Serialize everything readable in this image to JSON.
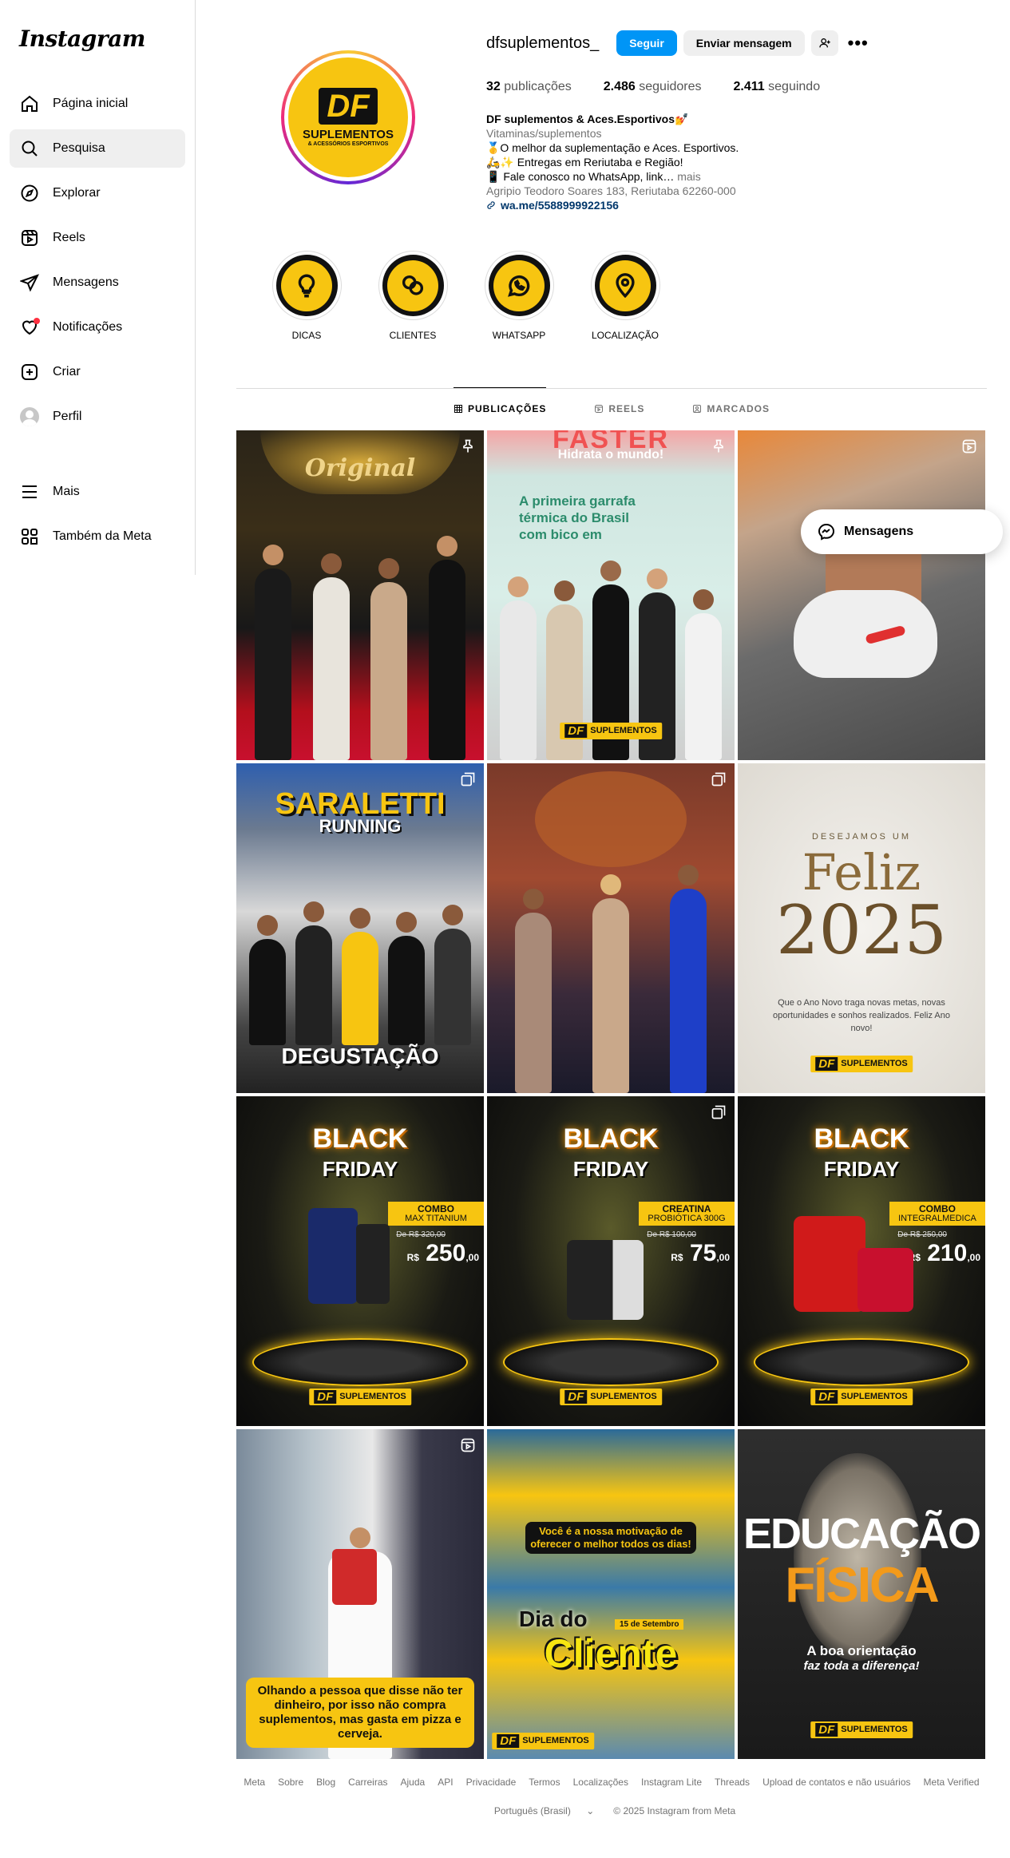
{
  "app": {
    "logo": "Instagram"
  },
  "sidebar": {
    "items": [
      {
        "label": "Página inicial",
        "icon": "home-icon"
      },
      {
        "label": "Pesquisa",
        "icon": "search-icon"
      },
      {
        "label": "Explorar",
        "icon": "compass-icon"
      },
      {
        "label": "Reels",
        "icon": "reels-icon"
      },
      {
        "label": "Mensagens",
        "icon": "send-icon"
      },
      {
        "label": "Notificações",
        "icon": "heart-icon"
      },
      {
        "label": "Criar",
        "icon": "plus-square-icon"
      },
      {
        "label": "Perfil",
        "icon": "avatar"
      }
    ],
    "bottom": [
      {
        "label": "Mais",
        "icon": "menu-icon"
      },
      {
        "label": "Também da Meta",
        "icon": "meta-apps-icon"
      }
    ]
  },
  "profile": {
    "username": "dfsuplementos_",
    "follow_label": "Seguir",
    "message_label": "Enviar mensagem",
    "stats": {
      "posts_count": "32",
      "posts_label": "publicações",
      "followers_count": "2.486",
      "followers_label": "seguidores",
      "following_count": "2.411",
      "following_label": "seguindo"
    },
    "pic": {
      "mark": "DF",
      "line1": "SUPLEMENTOS",
      "line2": "& ACESSÓRIOS ESPORTIVOS"
    },
    "bio": {
      "name": "DF suplementos & Aces.Esportivos💅",
      "category": "Vitaminas/suplementos",
      "line1": "🥇O melhor da suplementação e Aces. Esportivos.",
      "line2": "🛵✨ Entregas em Reriutaba e Região!",
      "line3": "📱 Fale conosco no WhatsApp, link…",
      "more": "mais",
      "address": "Agripio Teodoro Soares 183, Reriutaba 62260-000",
      "link": "wa.me/5588999922156"
    }
  },
  "highlights": [
    {
      "label": "DICAS",
      "icon": "lightbulb-icon"
    },
    {
      "label": "CLIENTES",
      "icon": "chat-people-icon"
    },
    {
      "label": "WHATSAPP",
      "icon": "whatsapp-icon"
    },
    {
      "label": "LOCALIZAÇÃO",
      "icon": "location-pin-icon"
    }
  ],
  "tabs": [
    {
      "label": "PUBLICAÇÕES",
      "icon": "grid-icon"
    },
    {
      "label": "REELS",
      "icon": "reels-icon"
    },
    {
      "label": "MARCADOS",
      "icon": "tag-icon"
    }
  ],
  "posts": {
    "p1": {
      "sign": "Original"
    },
    "p2": {
      "top": "FASTER",
      "sub": "Hidrata o mundo!",
      "text": "A primeira garrafa térmica do Brasil com bico em"
    },
    "p4": {
      "title": "SARALETTI",
      "sub": "RUNNING",
      "bottom": "DEGUSTAÇÃO"
    },
    "p6": {
      "top": "DESEJAMOS UM",
      "feliz": "Feliz",
      "year": "2025",
      "msg": "Que o Ano Novo traga novas metas, novas oportunidades e sonhos realizados. Feliz Ano novo!"
    },
    "bf_title": "BLACK",
    "bf_sub": "FRIDAY",
    "p7": {
      "tag1": "COMBO",
      "tag2": "MAX TITANIUM",
      "old": "De R$ 320,00",
      "price": "250",
      "cents": ",00",
      "prefix": "R$"
    },
    "p8": {
      "tag1": "CREATINA",
      "tag2": "PROBIÓTICA 300G",
      "old": "De R$ 100,00",
      "price": "75",
      "cents": ",00",
      "prefix": "R$"
    },
    "p9": {
      "tag1": "COMBO",
      "tag2": "INTEGRALMEDICA",
      "old": "De R$ 250,00",
      "price": "210",
      "cents": ",00",
      "prefix": "R$"
    },
    "p10": {
      "caption": "Olhando a pessoa que disse não ter dinheiro, por isso não compra suplementos, mas gasta em pizza e cerveja."
    },
    "p11": {
      "banner": "Você é a nossa motivação de oferecer o melhor todos os dias!",
      "dia": "Dia do",
      "date": "15 de Setembro",
      "cliente": "Cliente"
    },
    "p12": {
      "t1": "EDUCAÇÃO",
      "t2": "FÍSICA",
      "msg1": "A boa orientação",
      "msg2": "faz toda a diferença!"
    },
    "brand_mark": "DF",
    "brand_text": "SUPLEMENTOS"
  },
  "messages_bubble": {
    "label": "Mensagens"
  },
  "footer": {
    "links": [
      "Meta",
      "Sobre",
      "Blog",
      "Carreiras",
      "Ajuda",
      "API",
      "Privacidade",
      "Termos",
      "Localizações",
      "Instagram Lite",
      "Threads",
      "Upload de contatos e não usuários",
      "Meta Verified"
    ],
    "language": "Português (Brasil)",
    "copyright": "© 2025 Instagram from Meta"
  },
  "colors": {
    "accent": "#0095f6",
    "brand_yellow": "#f7c511",
    "notification": "#ff3040"
  }
}
